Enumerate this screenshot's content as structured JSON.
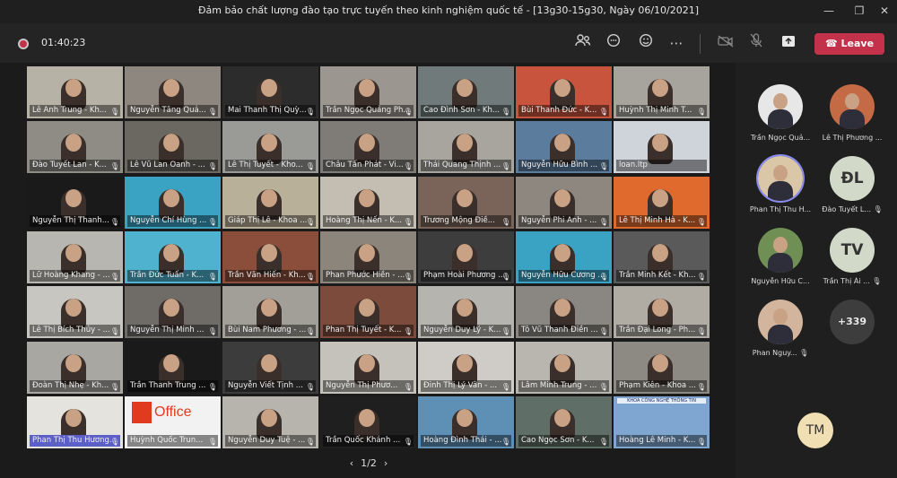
{
  "window": {
    "title": "Đảm bảo chất lượng đào tạo trực tuyến theo kinh nghiệm quốc tế - [13g30-15g30, Ngày 06/10/2021]"
  },
  "toolbar": {
    "timer": "01:40:23",
    "leave_label": "Leave"
  },
  "pager": {
    "label": "1/2",
    "prev": "‹",
    "next": "›"
  },
  "tiles": [
    {
      "name": "Lê Anh Trung - Kh...",
      "bg": "#b7b2a6"
    },
    {
      "name": "Nguyễn Tăng Quả...",
      "bg": "#8e8780"
    },
    {
      "name": "Mai Thanh Thị Quỳ...",
      "bg": "#2c2c2c"
    },
    {
      "name": "Trần Ngọc Quảng Ph...",
      "bg": "#9b9690"
    },
    {
      "name": "Cao Đình Sơn - Kh...",
      "bg": "#707a7a"
    },
    {
      "name": "Bùi Thanh Đức - K...",
      "bg": "#c9543e"
    },
    {
      "name": "Huỳnh Thị Minh T...",
      "bg": "#a7a49d"
    },
    {
      "name": "Đào Tuyết Lan - K...",
      "bg": "#8f8b85"
    },
    {
      "name": "Lê Vũ Lan Oanh - ...",
      "bg": "#6b6761"
    },
    {
      "name": "Lê Thị Tuyết - Kho...",
      "bg": "#9a9b97"
    },
    {
      "name": "Châu Tấn Phát - Vi...",
      "bg": "#7f7c77"
    },
    {
      "name": "Thái Quang Thịnh ...",
      "bg": "#a8a59f"
    },
    {
      "name": "Nguyễn Hữu Bình ...",
      "bg": "#5c7c9e"
    },
    {
      "name": "loan.ltp",
      "bg": "#cfd4da"
    },
    {
      "name": "Nguyễn Thị Thanh...",
      "bg": "#1a1a1a"
    },
    {
      "name": "Nguyễn Chí Hùng ...",
      "bg": "#3aa3c4"
    },
    {
      "name": "Giáp Thị Lê - Khoa ...",
      "bg": "#b8b098"
    },
    {
      "name": "Hoàng Thị Nến - K...",
      "bg": "#c4beb2"
    },
    {
      "name": "Trương Mộng Điề...",
      "bg": "#7a6459"
    },
    {
      "name": "Nguyễn Phi Anh - ...",
      "bg": "#8d8780"
    },
    {
      "name": "Lê Thị Minh Hà - K...",
      "bg": "#e06a2e"
    },
    {
      "name": "Lữ Hoàng Khang - ...",
      "bg": "#b8b6b0"
    },
    {
      "name": "Trần Đức Tuấn - K...",
      "bg": "#4fb3cf"
    },
    {
      "name": "Trần Văn Hiến - Kh...",
      "bg": "#8a4e3a"
    },
    {
      "name": "Phan Phước Hiền - ...",
      "bg": "#8c857c"
    },
    {
      "name": "Phạm Hoài Phương ...",
      "bg": "#3d3d3d"
    },
    {
      "name": "Nguyễn Hữu Cương ...",
      "bg": "#3aa3c4"
    },
    {
      "name": "Trần Minh Kết - Kh...",
      "bg": "#5a5a5a"
    },
    {
      "name": "Lê Thị Bích Thủy - ...",
      "bg": "#c8c6c0"
    },
    {
      "name": "Nguyễn Thị Minh ...",
      "bg": "#6f6c68"
    },
    {
      "name": "Bùi Nam Phương - ...",
      "bg": "#a29f98"
    },
    {
      "name": "Phan Thị Tuyết - K...",
      "bg": "#7d4b3c"
    },
    {
      "name": "Nguyễn Duy Lý - K...",
      "bg": "#b6b4ae"
    },
    {
      "name": "Tô Vũ Thanh Điền ...",
      "bg": "#8a8782"
    },
    {
      "name": "Trần Đại Long - Ph...",
      "bg": "#b0aca4"
    },
    {
      "name": "Đoàn Thị Nhẹ - Kh...",
      "bg": "#a9a7a2"
    },
    {
      "name": "Trần Thanh Trung ...",
      "bg": "#1a1a1a"
    },
    {
      "name": "Nguyễn Viết Tịnh ...",
      "bg": "#3c3c3c"
    },
    {
      "name": "Nguyễn Thị Phươ...",
      "bg": "#c5c2bc"
    },
    {
      "name": "Đinh Thị Lý Vân - ...",
      "bg": "#cfccc7"
    },
    {
      "name": "Lâm Minh Trung - ...",
      "bg": "#b9b6b0"
    },
    {
      "name": "Phạm Kiên - Khoa ...",
      "bg": "#8d8a84"
    },
    {
      "name": "Phan Thị Thu Hương...",
      "bg": "#e5e3de",
      "highlight": true
    },
    {
      "name": "Huỳnh Quốc Trun...",
      "bg": "#f2f2f2",
      "office": "Office"
    },
    {
      "name": "Nguyễn Duy Tuệ - ...",
      "bg": "#b7b4ae"
    },
    {
      "name": "Trần Quốc Khánh ...",
      "bg": "#1f1f1f"
    },
    {
      "name": "Hoàng Đình Thái - ...",
      "bg": "#5e8fb4"
    },
    {
      "name": "Cao Ngọc Sơn - K...",
      "bg": "#5f6e66"
    },
    {
      "name": "Hoàng Lê Minh - K...",
      "bg": "#7ea6d0",
      "banner": "KHOA CÔNG NGHỆ THÔNG TIN"
    }
  ],
  "rail": [
    {
      "name": "Trần Ngọc Quả...",
      "initials": "",
      "photo": "#e7e7e7"
    },
    {
      "name": "Lê Thị Phương ...",
      "initials": "",
      "photo": "#c46b45"
    },
    {
      "name": "Phan Thị Thu H...",
      "initials": "",
      "photo": "#d9c7a7",
      "active": true
    },
    {
      "name": "Đào Tuyết L...",
      "initials": "ĐL",
      "muted": true
    },
    {
      "name": "Nguyễn Hữu C...",
      "initials": "",
      "photo": "#6f8f55"
    },
    {
      "name": "Trần Thị Ái ...",
      "initials": "TV",
      "muted": true
    },
    {
      "name": "Phan Nguy...",
      "initials": "",
      "photo": "#d2b59c",
      "muted": true
    },
    {
      "name": "",
      "initials": "+339",
      "more": true
    }
  ],
  "bottom_avatar": "TM"
}
